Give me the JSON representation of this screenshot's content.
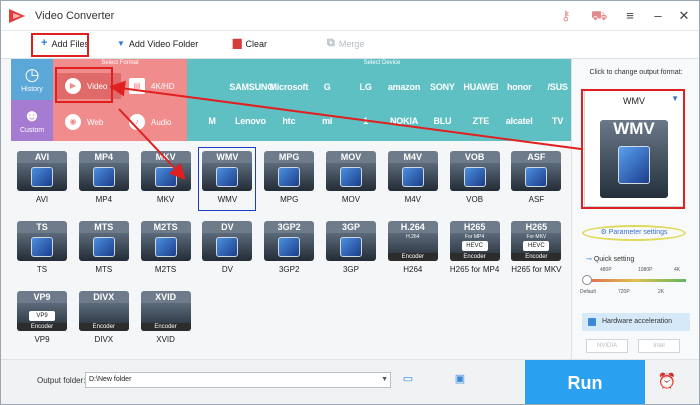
{
  "app": {
    "title": "Video Converter"
  },
  "titlebar_icons": [
    "key-icon",
    "cart-icon",
    "menu-icon",
    "minimize-icon",
    "close-icon"
  ],
  "toolbar": {
    "add_files": "Add Files",
    "add_video_folder": "Add Video Folder",
    "clear": "Clear",
    "merge": "Merge"
  },
  "categories": {
    "history": "History",
    "custom": "Custom",
    "select_format": "Select Format",
    "select_device": "Select Device",
    "formats": [
      {
        "label": "Video",
        "icon": "play-icon",
        "selected": true
      },
      {
        "label": "4K/HD",
        "icon": "film-icon",
        "selected": false
      },
      {
        "label": "Web",
        "icon": "chrome-icon",
        "selected": false
      },
      {
        "label": "Audio",
        "icon": "music-icon",
        "selected": false
      }
    ],
    "brands_row1": [
      "",
      "SAMSUNG",
      "Microsoft",
      "G",
      "LG",
      "amazon",
      "SONY",
      "HUAWEI",
      "honor",
      "/SUS"
    ],
    "brands_row2": [
      "M",
      "Lenovo",
      "htc",
      "mi",
      "1",
      "NOKIA",
      "BLU",
      "ZTE",
      "alcatel",
      "TV"
    ]
  },
  "formats": [
    {
      "label": "AVI",
      "band": "AVI",
      "color": "#6d7b8a"
    },
    {
      "label": "MP4",
      "band": "MP4",
      "color": "#6d7b8a"
    },
    {
      "label": "MKV",
      "band": "MKV",
      "color": "#6d7b8a"
    },
    {
      "label": "WMV",
      "band": "WMV",
      "color": "#6d7b8a",
      "selected": true
    },
    {
      "label": "MPG",
      "band": "MPG",
      "color": "#6d7b8a"
    },
    {
      "label": "MOV",
      "band": "MOV",
      "color": "#6d7b8a"
    },
    {
      "label": "M4V",
      "band": "M4V",
      "color": "#6d7b8a"
    },
    {
      "label": "VOB",
      "band": "VOB",
      "color": "#6d7b8a"
    },
    {
      "label": "ASF",
      "band": "ASF",
      "color": "#6d7b8a"
    },
    {
      "label": "TS",
      "band": "TS",
      "color": "#6d7b8a"
    },
    {
      "label": "MTS",
      "band": "MTS",
      "color": "#6d7b8a"
    },
    {
      "label": "M2TS",
      "band": "M2TS",
      "color": "#6d7b8a"
    },
    {
      "label": "DV",
      "band": "DV",
      "color": "#6d7b8a"
    },
    {
      "label": "3GP2",
      "band": "3GP2",
      "color": "#6d7b8a"
    },
    {
      "label": "3GP",
      "band": "3GP",
      "color": "#6d7b8a"
    },
    {
      "label": "H264",
      "band": "H.264",
      "color": "#6d7b8a",
      "encoder": "Encoder",
      "sub": "H.264"
    },
    {
      "label": "H265 for MP4",
      "band": "H265",
      "color": "#6d7b8a",
      "encoder": "Encoder",
      "sub": "For MP4",
      "hevc": "HEVC"
    },
    {
      "label": "H265 for MKV",
      "band": "H265",
      "color": "#6d7b8a",
      "encoder": "Encoder",
      "sub": "For MKV",
      "hevc": "HEVC"
    },
    {
      "label": "VP9",
      "band": "VP9",
      "color": "#6d7b8a",
      "encoder": "Encoder",
      "hevc": "VP9"
    },
    {
      "label": "DIVX",
      "band": "DIVX",
      "color": "#6d7b8a",
      "encoder": "Encoder"
    },
    {
      "label": "XVID",
      "band": "XVID",
      "color": "#6d7b8a",
      "encoder": "Encoder"
    }
  ],
  "output": {
    "click_to_change": "Click to change output format:",
    "format_name": "WMV",
    "big_icon_text": "WMV",
    "parameter_settings": "Parameter settings",
    "quick_setting": "Quick setting",
    "slider_labels_top": [
      "480P",
      "1080P",
      "4K"
    ],
    "slider_labels_bottom": [
      "Default",
      "720P",
      "2K"
    ],
    "hardware_acceleration": "Hardware acceleration",
    "gpu": [
      "NVIDIA",
      "Intel"
    ]
  },
  "bottom": {
    "output_folder_label": "Output folder:",
    "output_folder_value": "D:\\New folder",
    "run": "Run"
  },
  "colors": {
    "accent": "#2aa0f0",
    "format_panel": "#f08c8c",
    "device_panel": "#5fc0c4",
    "highlight": "#e02020",
    "history": "#5aa7d8",
    "custom": "#a67bd2"
  }
}
